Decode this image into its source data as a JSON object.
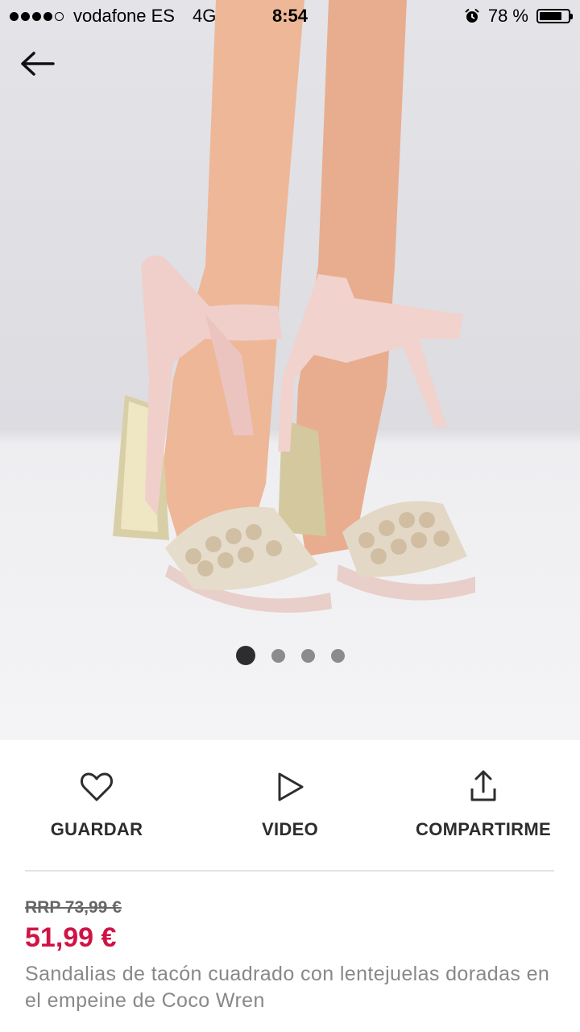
{
  "status_bar": {
    "carrier": "vodafone ES",
    "network": "4G",
    "time": "8:54",
    "battery": "78 %",
    "battery_level": 0.78
  },
  "gallery": {
    "image_count": 4,
    "active_index": 0
  },
  "actions": {
    "save_label": "GUARDAR",
    "video_label": "VIDEO",
    "share_label": "COMPARTIRME"
  },
  "product": {
    "rrp": "RRP 73,99 €",
    "price": "51,99 €",
    "description": "Sandalias de tacón cuadrado con lentejuelas doradas en el empeine de Coco Wren"
  },
  "colors": {
    "price": "#d01345",
    "text_dark": "#2d2d2d",
    "text_muted": "#888888"
  },
  "icons": [
    "back-arrow-icon",
    "alarm-icon",
    "battery-icon",
    "heart-icon",
    "play-icon",
    "share-icon"
  ]
}
